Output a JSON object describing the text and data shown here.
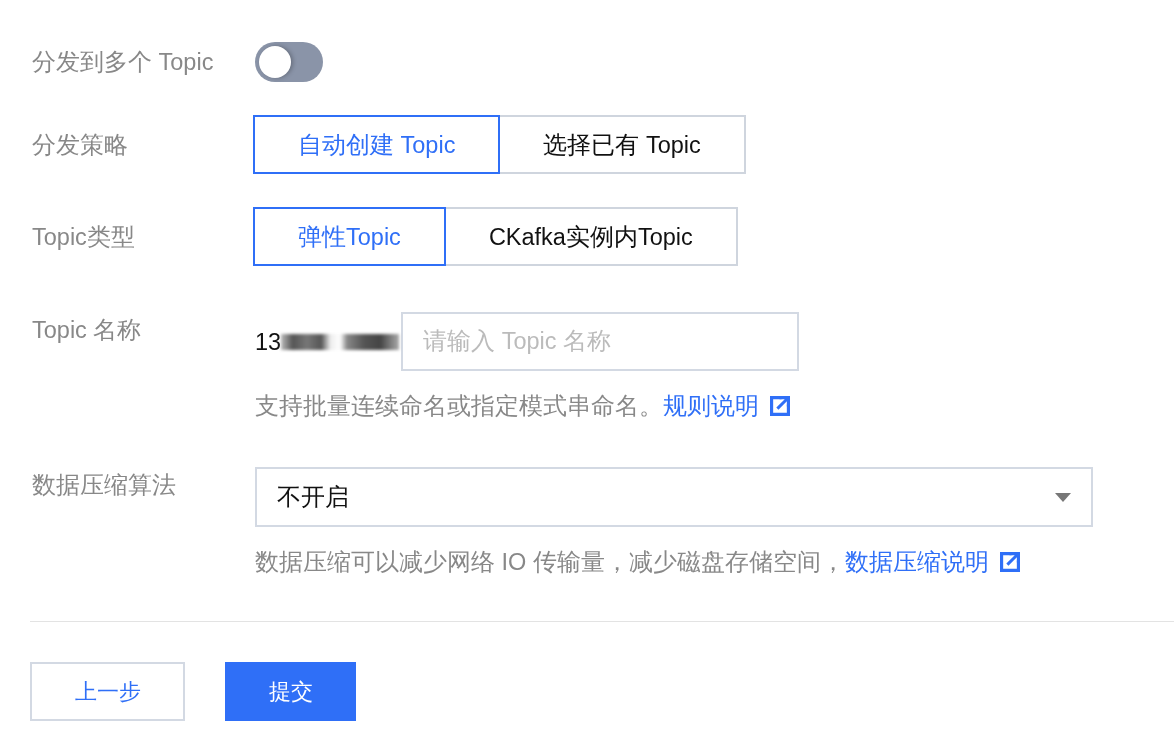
{
  "form": {
    "fields": [
      {
        "kind": "toggle",
        "label": "分发到多个 Topic",
        "on": false
      },
      {
        "kind": "segmented",
        "label": "分发策略",
        "options": [
          {
            "label": "自动创建 Topic",
            "selected": true
          },
          {
            "label": "选择已有 Topic",
            "selected": false
          }
        ]
      },
      {
        "kind": "segmented",
        "label": "Topic类型",
        "options": [
          {
            "label": "弹性Topic",
            "selected": true
          },
          {
            "label": "CKafka实例内Topic",
            "selected": false
          }
        ]
      },
      {
        "kind": "text_input",
        "label": "Topic 名称",
        "prefix": "13",
        "prefix_blurred": true,
        "placeholder": "请输入 Topic 名称",
        "help": {
          "text": "支持批量连续命名或指定模式串命名。",
          "link": "规则说明"
        }
      },
      {
        "kind": "select",
        "label": "数据压缩算法",
        "value": "不开启",
        "help": {
          "text": "数据压缩可以减少网络 IO 传输量，减少磁盘存储空间，",
          "link": "数据压缩说明"
        }
      }
    ]
  },
  "buttons": [
    {
      "label": "上一步",
      "kind": "secondary"
    },
    {
      "label": "提交",
      "kind": "primary"
    }
  ]
}
